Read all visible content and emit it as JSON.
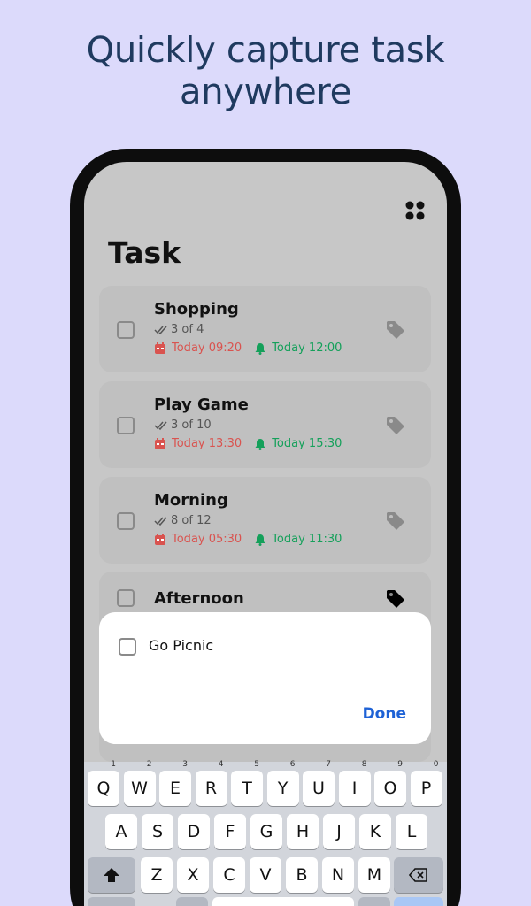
{
  "headline": "Quickly capture task anywhere",
  "page_title": "Task",
  "colors": {
    "background": "#dcdafb",
    "headline": "#1f3a5f",
    "due": "#d9534f",
    "reminder": "#14a05a",
    "done": "#1e62d6"
  },
  "tasks": [
    {
      "title": "Shopping",
      "progress": "3 of 4",
      "due": "Today 09:20",
      "reminder": "Today 12:00"
    },
    {
      "title": "Play Game",
      "progress": "3 of 10",
      "due": "Today 13:30",
      "reminder": "Today 15:30"
    },
    {
      "title": "Morning",
      "progress": "8 of 12",
      "due": "Today 05:30",
      "reminder": "Today 11:30"
    },
    {
      "title": "Afternoon"
    }
  ],
  "sheet": {
    "input_value": "Go Picnic",
    "done_label": "Done"
  },
  "keyboard": {
    "row1": [
      {
        "k": "Q",
        "n": "1"
      },
      {
        "k": "W",
        "n": "2"
      },
      {
        "k": "E",
        "n": "3"
      },
      {
        "k": "R",
        "n": "4"
      },
      {
        "k": "T",
        "n": "5"
      },
      {
        "k": "Y",
        "n": "6"
      },
      {
        "k": "U",
        "n": "7"
      },
      {
        "k": "I",
        "n": "8"
      },
      {
        "k": "O",
        "n": "9"
      },
      {
        "k": "P",
        "n": "0"
      }
    ],
    "row2": [
      "A",
      "S",
      "D",
      "F",
      "G",
      "H",
      "J",
      "K",
      "L"
    ],
    "row3": [
      "Z",
      "X",
      "C",
      "V",
      "B",
      "N",
      "M"
    ]
  }
}
